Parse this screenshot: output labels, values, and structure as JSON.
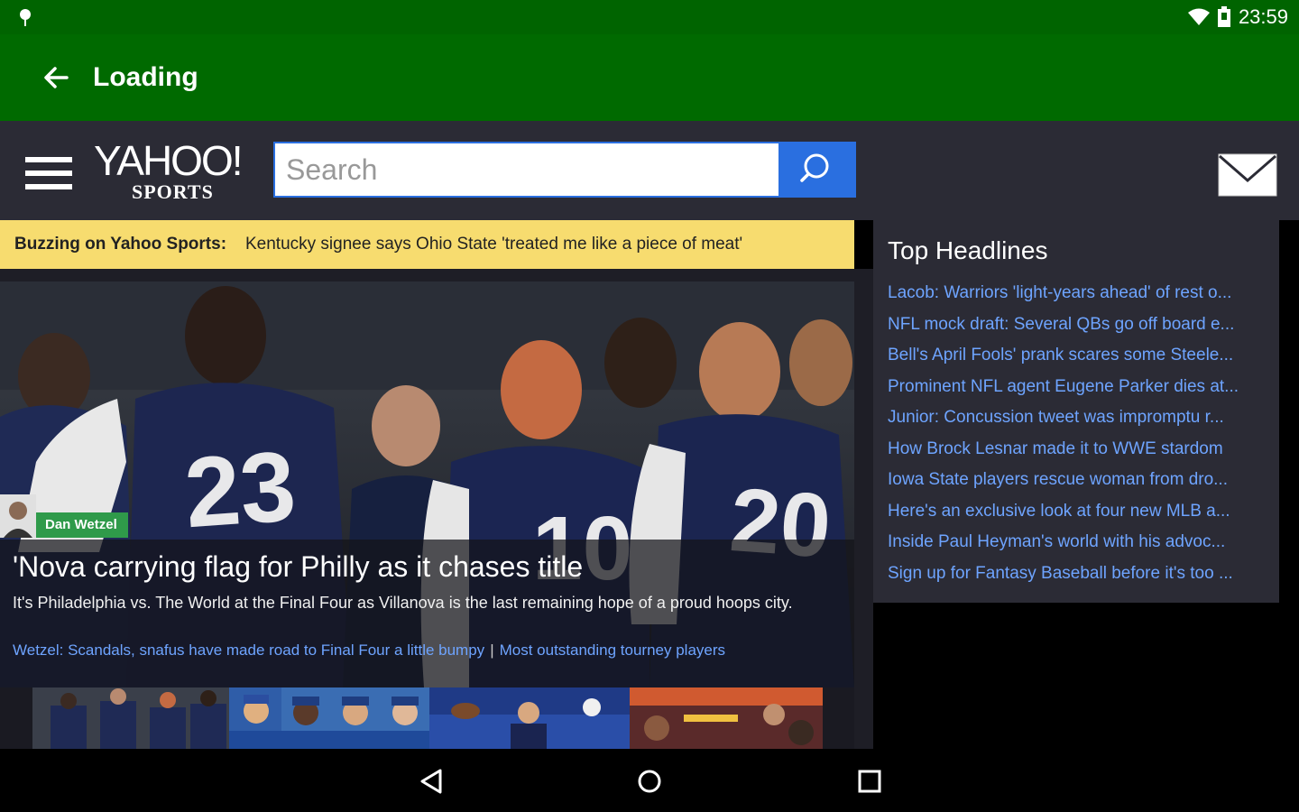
{
  "status_bar": {
    "time": "23:59",
    "left_icon": "location-pin-icon",
    "icons": [
      "wifi-icon",
      "battery-icon"
    ]
  },
  "app_bar": {
    "title": "Loading",
    "back_icon": "arrow-back-icon"
  },
  "header": {
    "logo_main": "YAHOO!",
    "logo_sub": "SPORTS",
    "search_placeholder": "Search",
    "search_icon": "search-icon",
    "mail_icon": "mail-icon"
  },
  "buzz": {
    "label": "Buzzing on Yahoo Sports:",
    "text": "Kentucky signee says Ohio State 'treated me like a piece of meat'"
  },
  "hero": {
    "author": "Dan Wetzel",
    "title": "'Nova carrying flag for Philly as it chases title",
    "description": "It's Philadelphia vs. The World at the Final Four as Villanova is the last remaining hope of a proud hoops city.",
    "links": [
      "Wetzel: Scandals, snafus have made road to Final Four a little bumpy",
      "Most outstanding tourney players"
    ]
  },
  "top_headlines": {
    "title": "Top Headlines",
    "items": [
      "Lacob: Warriors 'light-years ahead' of rest o...",
      "NFL mock draft: Several QBs go off board e...",
      "Bell's April Fools' prank scares some Steele...",
      "Prominent NFL agent Eugene Parker dies at...",
      "Junior: Concussion tweet was impromptu r...",
      "How Brock Lesnar made it to WWE stardom",
      "Iowa State players rescue woman from dro...",
      "Here's an exclusive look at four new MLB a...",
      "Inside Paul Heyman's world with his advoc...",
      "Sign up for Fantasy Baseball before it's too ..."
    ]
  },
  "colors": {
    "status_green": "#006400",
    "appbar_green": "#006a00",
    "header_dark": "#2b2b35",
    "accent_blue": "#2a6fe0",
    "link_blue": "#6ea4ff",
    "buzz_yellow": "#f7dc6f"
  }
}
